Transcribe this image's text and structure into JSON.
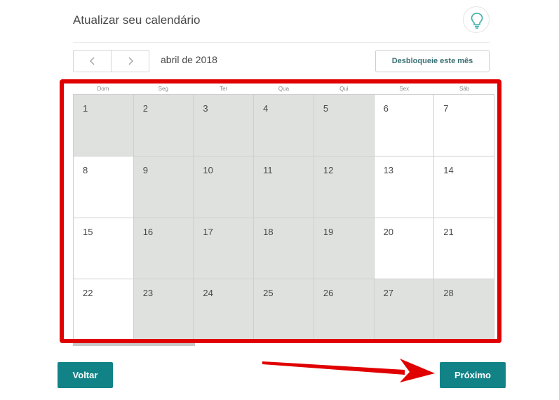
{
  "header": {
    "title": "Atualizar seu calendário",
    "tip_icon": "lightbulb-icon"
  },
  "toolbar": {
    "prev_icon": "chevron-left-icon",
    "next_icon": "chevron-right-icon",
    "month_label": "abril de 2018",
    "unlock_label": "Desbloqueie este mês"
  },
  "calendar": {
    "weekdays": [
      "Dom",
      "Seg",
      "Ter",
      "Qua",
      "Qui",
      "Sex",
      "Sáb"
    ],
    "weeks": [
      [
        {
          "day": "1",
          "blocked": true
        },
        {
          "day": "2",
          "blocked": true
        },
        {
          "day": "3",
          "blocked": true
        },
        {
          "day": "4",
          "blocked": true
        },
        {
          "day": "5",
          "blocked": true
        },
        {
          "day": "6",
          "blocked": false
        },
        {
          "day": "7",
          "blocked": false
        }
      ],
      [
        {
          "day": "8",
          "blocked": false
        },
        {
          "day": "9",
          "blocked": true
        },
        {
          "day": "10",
          "blocked": true
        },
        {
          "day": "11",
          "blocked": true
        },
        {
          "day": "12",
          "blocked": true
        },
        {
          "day": "13",
          "blocked": false
        },
        {
          "day": "14",
          "blocked": false
        }
      ],
      [
        {
          "day": "15",
          "blocked": false
        },
        {
          "day": "16",
          "blocked": true
        },
        {
          "day": "17",
          "blocked": true
        },
        {
          "day": "18",
          "blocked": true
        },
        {
          "day": "19",
          "blocked": true
        },
        {
          "day": "20",
          "blocked": false
        },
        {
          "day": "21",
          "blocked": false
        }
      ],
      [
        {
          "day": "22",
          "blocked": false
        },
        {
          "day": "23",
          "blocked": true
        },
        {
          "day": "24",
          "blocked": true
        },
        {
          "day": "25",
          "blocked": true
        },
        {
          "day": "26",
          "blocked": true
        },
        {
          "day": "27",
          "blocked": true
        },
        {
          "day": "28",
          "blocked": true
        }
      ]
    ]
  },
  "footer": {
    "back_label": "Voltar",
    "next_label": "Próximo"
  },
  "colors": {
    "accent": "#118387",
    "blocked_day": "#dfe1df",
    "annotation_red": "#e00000"
  }
}
